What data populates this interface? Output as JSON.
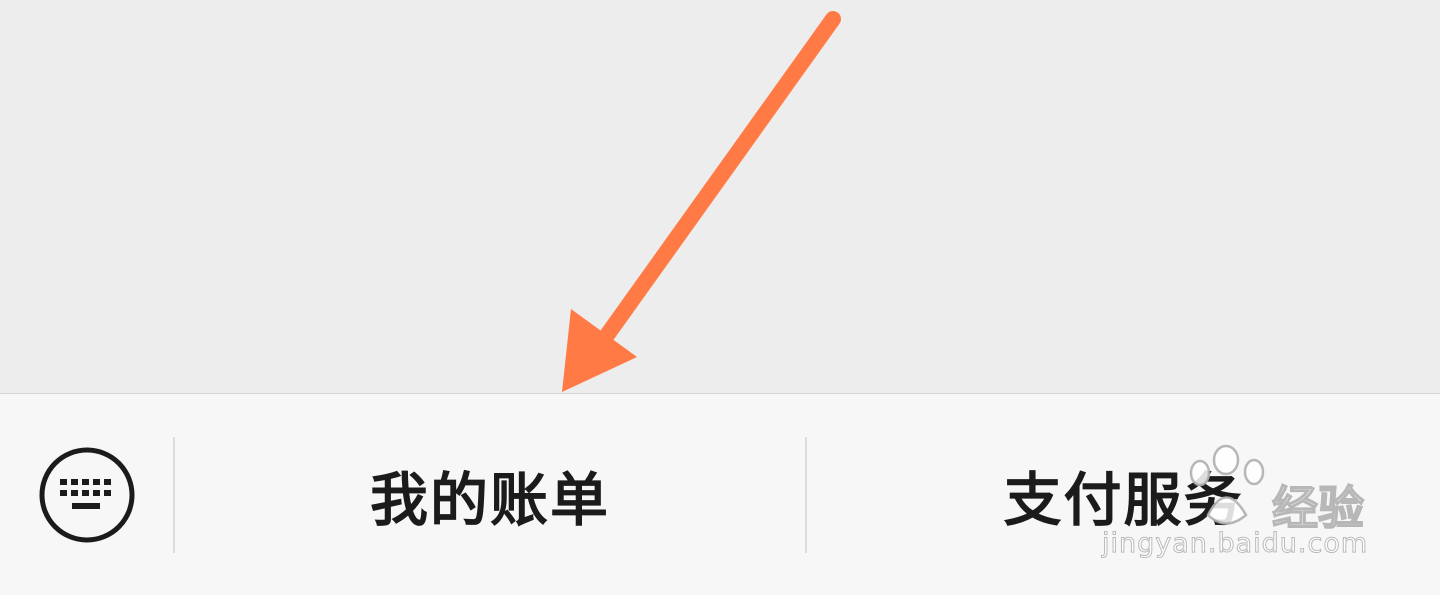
{
  "menu": {
    "keyboard_icon": "keyboard-icon",
    "items": [
      {
        "label": "我的账单"
      },
      {
        "label": "支付服务"
      }
    ]
  },
  "annotation": {
    "arrow_color": "#ff7a45"
  },
  "watermark": {
    "brand": "经验",
    "url": "jingyan.baidu.com"
  },
  "colors": {
    "background": "#ededed",
    "menu_bar": "#f7f7f7",
    "text": "#1b1b1b"
  }
}
